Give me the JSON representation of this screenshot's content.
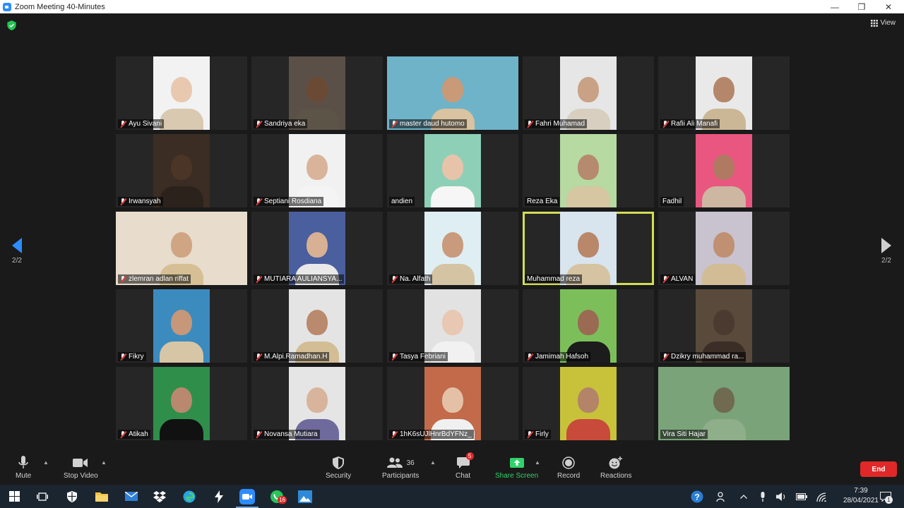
{
  "window": {
    "title": "Zoom Meeting 40-Minutes"
  },
  "header": {
    "view_label": "View"
  },
  "pager": {
    "left": "2/2",
    "right": "2/2"
  },
  "participants_grid": [
    {
      "name": "Ayu Sivani",
      "muted": true,
      "wide": false,
      "skin": "#e8c9b0",
      "bg": "#f2f2f2",
      "shirt": "#d8c9b0"
    },
    {
      "name": "Sandriya eka",
      "muted": true,
      "wide": false,
      "skin": "#6a4a35",
      "bg": "#5a5048",
      "shirt": "#5d5448"
    },
    {
      "name": "master daud hutomo",
      "muted": true,
      "wide": true,
      "skin": "#c99a77",
      "bg": "#6fb3c9",
      "shirt": "#d9c3a0"
    },
    {
      "name": "Fahri Muhamad",
      "muted": true,
      "wide": false,
      "skin": "#c9a184",
      "bg": "#e6e6e6",
      "shirt": "#d8cfc0"
    },
    {
      "name": "Rafii Ali Manafi",
      "muted": true,
      "wide": false,
      "skin": "#b5876a",
      "bg": "#e9e9e9",
      "shirt": "#cbb795"
    },
    {
      "name": "Irwansyah",
      "muted": true,
      "wide": false,
      "skin": "#4b3526",
      "bg": "#3b2d24",
      "shirt": "#2c221c"
    },
    {
      "name": "Septiani Rosdiana",
      "muted": true,
      "wide": false,
      "skin": "#d9b49a",
      "bg": "#f1f1f1",
      "shirt": "#f4f4f4"
    },
    {
      "name": "andien",
      "muted": false,
      "wide": false,
      "skin": "#e7c3aa",
      "bg": "#8ed0b7",
      "shirt": "#f6f6f6"
    },
    {
      "name": "Reza Eka",
      "muted": false,
      "wide": false,
      "skin": "#b58a6e",
      "bg": "#b7d9a2",
      "shirt": "#d6c6a2"
    },
    {
      "name": "Fadhil",
      "muted": false,
      "wide": false,
      "skin": "#b07a62",
      "bg": "#e9567f",
      "shirt": "#cdb6a2"
    },
    {
      "name": "zlemran adlan riffat",
      "muted": true,
      "wide": true,
      "skin": "#cfa584",
      "bg": "#e8dccc",
      "shirt": "#d6bf95"
    },
    {
      "name": "MUTIARA AULIANSYA...",
      "muted": true,
      "wide": false,
      "skin": "#d8b094",
      "bg": "#4a5f9e",
      "shirt": "#e9e9e9"
    },
    {
      "name": "Na. Alfath",
      "muted": true,
      "wide": false,
      "skin": "#c99a7c",
      "bg": "#dfeef3",
      "shirt": "#d4c4a4"
    },
    {
      "name": "Muhammad reza",
      "muted": false,
      "wide": false,
      "skin": "#b9876a",
      "bg": "#d8e4ee",
      "shirt": "#d5c3a1"
    },
    {
      "name": "ALVAN",
      "muted": true,
      "wide": false,
      "skin": "#c09072",
      "bg": "#c9c3cf",
      "shirt": "#d1bc96"
    },
    {
      "name": "Fikry",
      "muted": true,
      "wide": false,
      "skin": "#c69779",
      "bg": "#3b8bbf",
      "shirt": "#d7c6a6"
    },
    {
      "name": "M.Alpi.Ramadhan.H",
      "muted": true,
      "wide": false,
      "skin": "#b98a6d",
      "bg": "#e4e4e4",
      "shirt": "#d3bd94"
    },
    {
      "name": "Tasya Febriani",
      "muted": true,
      "wide": false,
      "skin": "#e8c7b3",
      "bg": "#e2e2e2",
      "shirt": "#f1f1f1"
    },
    {
      "name": "Jamimah Hafsoh",
      "muted": true,
      "wide": false,
      "skin": "#9a6b52",
      "bg": "#7cbf5a",
      "shirt": "#1c1c1c"
    },
    {
      "name": "Dzikry muhammad ra...",
      "muted": true,
      "wide": false,
      "skin": "#4a3a30",
      "bg": "#5a4a3c",
      "shirt": "#3a2e26"
    },
    {
      "name": "Atikah",
      "muted": true,
      "wide": false,
      "skin": "#b9886e",
      "bg": "#2f8f4a",
      "shirt": "#111111"
    },
    {
      "name": "Novansa Mutiara",
      "muted": true,
      "wide": false,
      "skin": "#d8b49c",
      "bg": "#e5e5e5",
      "shirt": "#6e6a9c"
    },
    {
      "name": "1hK6sUJlHnrBdYFNz_",
      "muted": true,
      "wide": false,
      "skin": "#e4c1a6",
      "bg": "#c26a4a",
      "shirt": "#f0f0f0"
    },
    {
      "name": "Firly",
      "muted": true,
      "wide": false,
      "skin": "#b38468",
      "bg": "#c7c23a",
      "shirt": "#c84a3a"
    },
    {
      "name": "Vira Siti Hajar",
      "muted": false,
      "wide": true,
      "skin": "#6f6a50",
      "bg": "#7aa37a",
      "shirt": "#8fae8a"
    }
  ],
  "active_speaker_index": 13,
  "toolbar": {
    "mute_label": "Mute",
    "stop_video_label": "Stop Video",
    "security_label": "Security",
    "participants_label": "Participants",
    "participants_count": "36",
    "chat_label": "Chat",
    "chat_badge": "5",
    "share_screen_label": "Share Screen",
    "record_label": "Record",
    "reactions_label": "Reactions",
    "end_label": "End",
    "share_color": "#2fd36a",
    "end_color": "#e02828"
  },
  "taskbar": {
    "whatsapp_badge": "16",
    "time": "7:39",
    "date": "28/04/2021",
    "notification_count": "1"
  }
}
